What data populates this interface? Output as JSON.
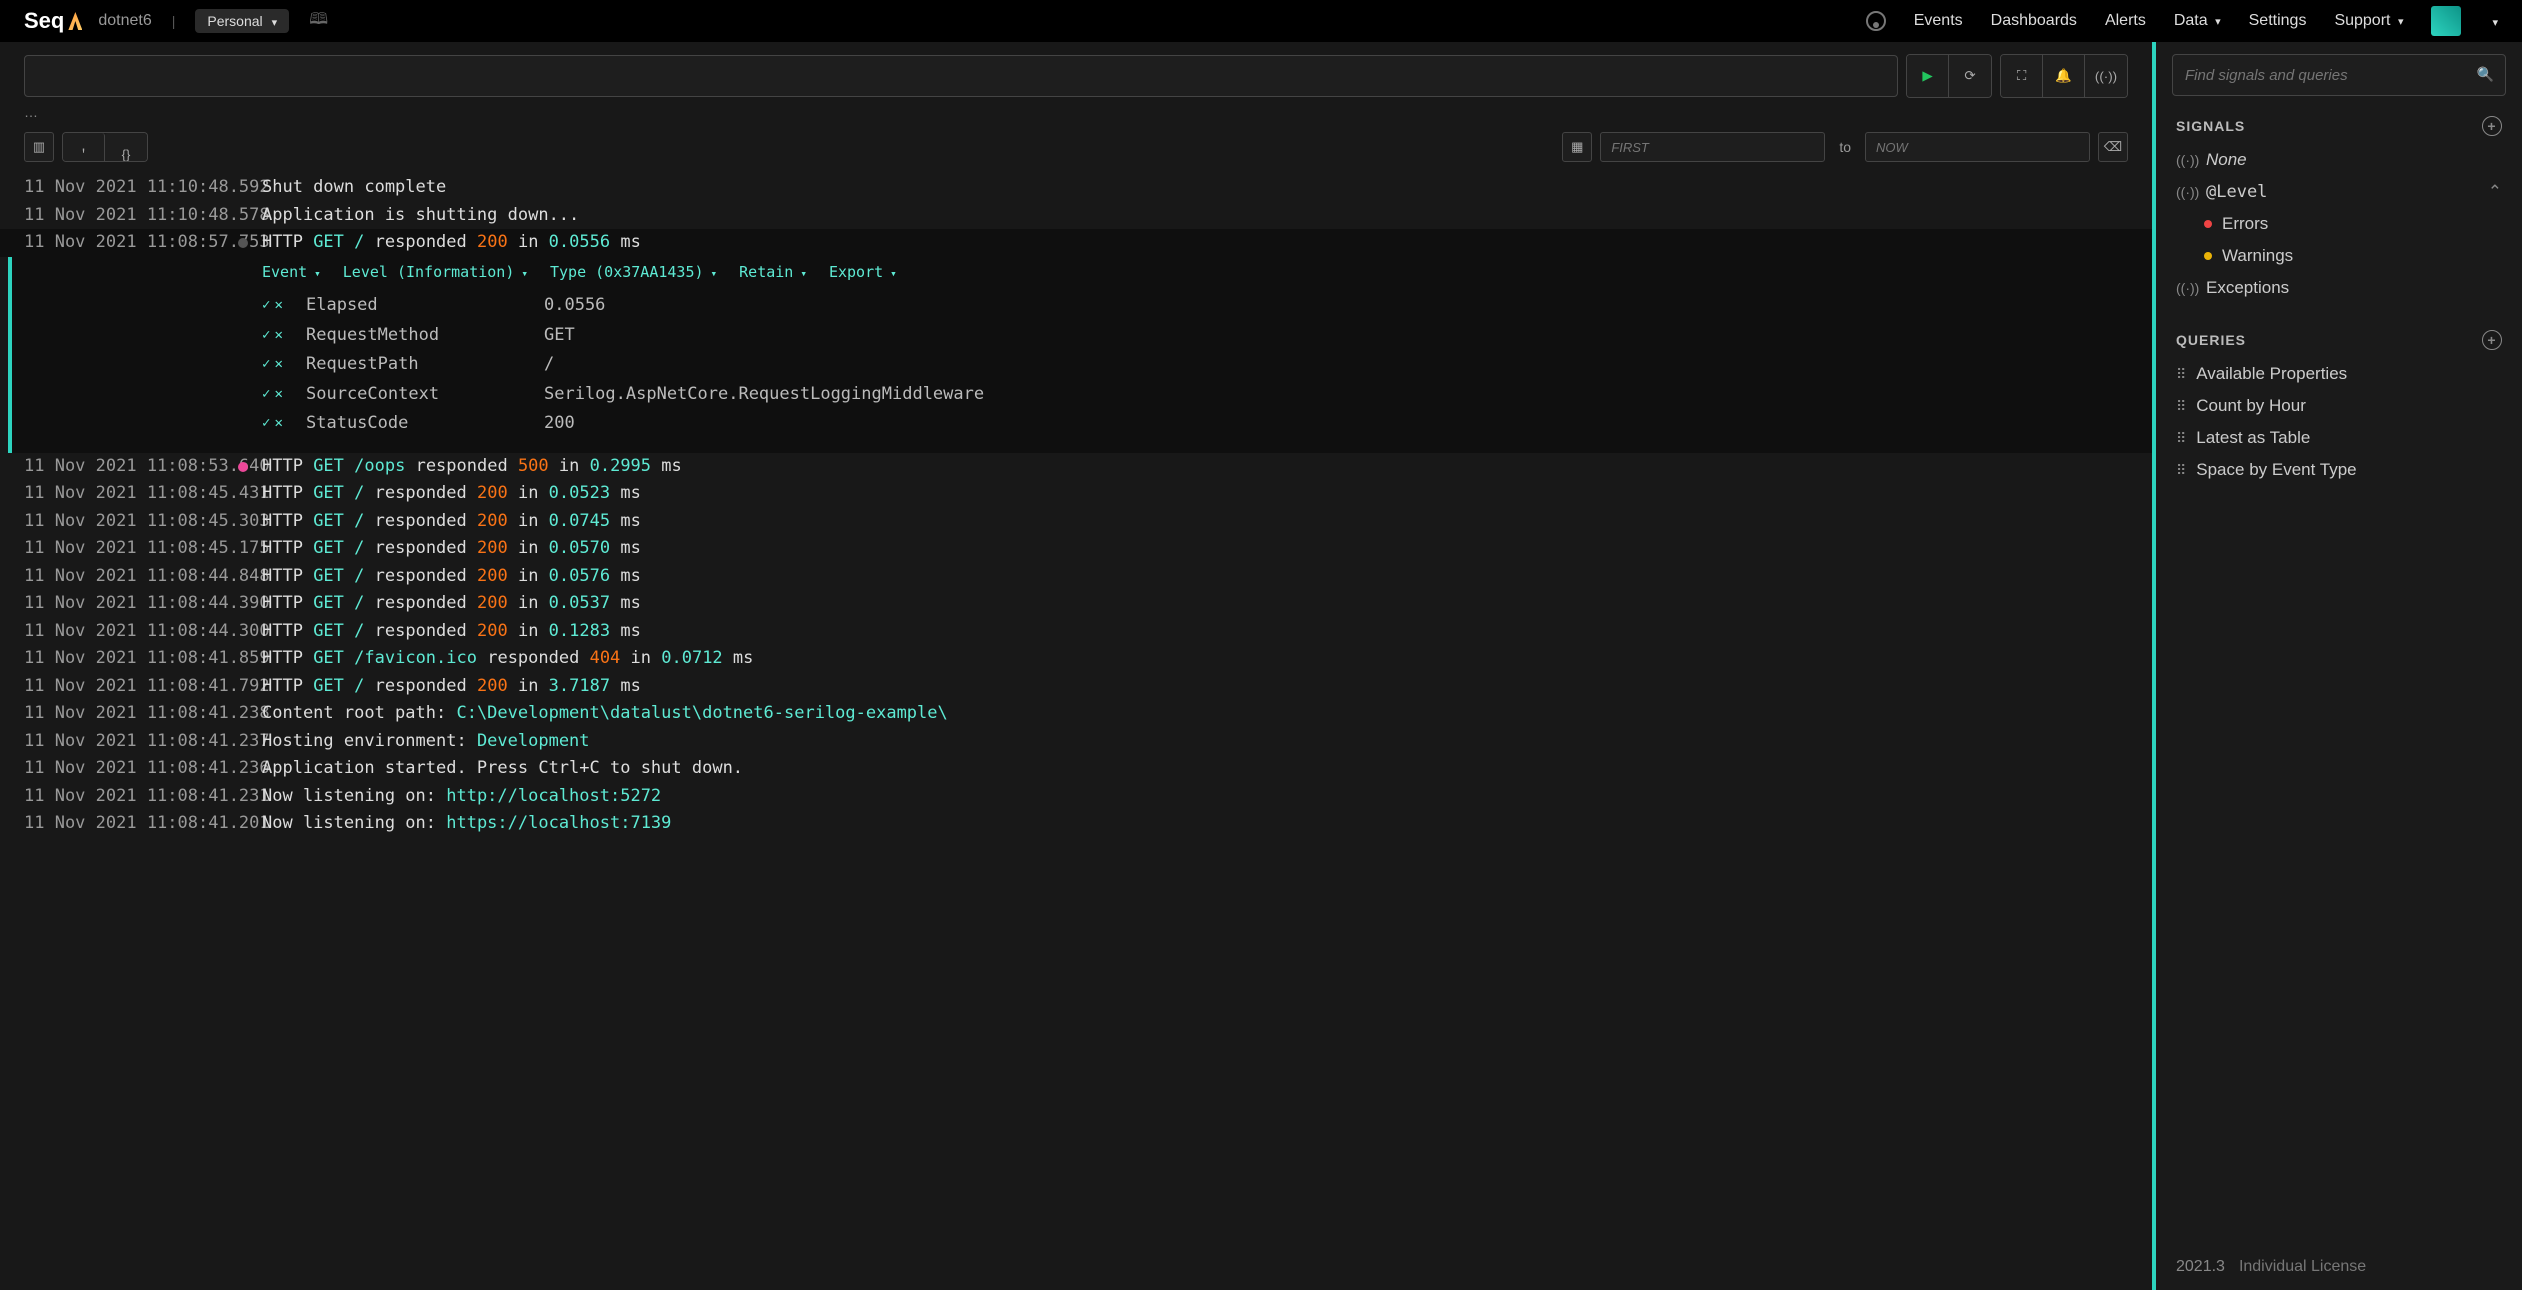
{
  "nav": {
    "logo": "Seq",
    "project": "dotnet6",
    "workspace": "Personal",
    "links": [
      "Events",
      "Dashboards",
      "Alerts",
      "Data",
      "Settings",
      "Support"
    ]
  },
  "query": {
    "ellipsis": "…",
    "from_placeholder": "FIRST",
    "to_placeholder": "NOW",
    "to_label": "to"
  },
  "events": [
    {
      "ts": "11 Nov 2021 11:10:48.592",
      "dot": "none",
      "msg": "Shut down complete"
    },
    {
      "ts": "11 Nov 2021 11:10:48.578",
      "dot": "none",
      "msg": "Application is shutting down..."
    },
    {
      "ts": "11 Nov 2021 11:08:57.753",
      "dot": "info",
      "expanded": true,
      "method": "GET",
      "path": "/",
      "status": "200",
      "elapsed": "0.0556"
    },
    {
      "ts": "11 Nov 2021 11:08:53.640",
      "dot": "error",
      "method": "GET",
      "path": "/oops",
      "status": "500",
      "elapsed": "0.2995"
    },
    {
      "ts": "11 Nov 2021 11:08:45.431",
      "dot": "none",
      "method": "GET",
      "path": "/",
      "status": "200",
      "elapsed": "0.0523"
    },
    {
      "ts": "11 Nov 2021 11:08:45.303",
      "dot": "none",
      "method": "GET",
      "path": "/",
      "status": "200",
      "elapsed": "0.0745"
    },
    {
      "ts": "11 Nov 2021 11:08:45.175",
      "dot": "none",
      "method": "GET",
      "path": "/",
      "status": "200",
      "elapsed": "0.0570"
    },
    {
      "ts": "11 Nov 2021 11:08:44.848",
      "dot": "none",
      "method": "GET",
      "path": "/",
      "status": "200",
      "elapsed": "0.0576"
    },
    {
      "ts": "11 Nov 2021 11:08:44.390",
      "dot": "none",
      "method": "GET",
      "path": "/",
      "status": "200",
      "elapsed": "0.0537"
    },
    {
      "ts": "11 Nov 2021 11:08:44.300",
      "dot": "none",
      "method": "GET",
      "path": "/",
      "status": "200",
      "elapsed": "0.1283"
    },
    {
      "ts": "11 Nov 2021 11:08:41.859",
      "dot": "none",
      "method": "GET",
      "path": "/favicon.ico",
      "status": "404",
      "elapsed": "0.0712"
    },
    {
      "ts": "11 Nov 2021 11:08:41.792",
      "dot": "none",
      "method": "GET",
      "path": "/",
      "status": "200",
      "elapsed": "3.7187"
    },
    {
      "ts": "11 Nov 2021 11:08:41.238",
      "dot": "none",
      "plain_prefix": "Content root path: ",
      "plain_hl": "C:\\Development\\datalust\\dotnet6-serilog-example\\"
    },
    {
      "ts": "11 Nov 2021 11:08:41.237",
      "dot": "none",
      "plain_prefix": "Hosting environment: ",
      "plain_hl": "Development"
    },
    {
      "ts": "11 Nov 2021 11:08:41.236",
      "dot": "none",
      "msg": "Application started. Press Ctrl+C to shut down."
    },
    {
      "ts": "11 Nov 2021 11:08:41.231",
      "dot": "none",
      "plain_prefix": "Now listening on: ",
      "plain_hl": "http://localhost:5272"
    },
    {
      "ts": "11 Nov 2021 11:08:41.201",
      "dot": "none",
      "plain_prefix": "Now listening on: ",
      "plain_hl": "https://localhost:7139"
    }
  ],
  "detail": {
    "actions": [
      "Event",
      "Level (Information)",
      "Type (0x37AA1435)",
      "Retain",
      "Export"
    ],
    "props": [
      {
        "k": "Elapsed",
        "v": "0.0556"
      },
      {
        "k": "RequestMethod",
        "v": "GET"
      },
      {
        "k": "RequestPath",
        "v": "/"
      },
      {
        "k": "SourceContext",
        "v": "Serilog.AspNetCore.RequestLoggingMiddleware"
      },
      {
        "k": "StatusCode",
        "v": "200"
      }
    ]
  },
  "sidebar": {
    "search_placeholder": "Find signals and queries",
    "signals_header": "SIGNALS",
    "queries_header": "QUERIES",
    "signals": {
      "none": "None",
      "level": "@Level",
      "errors": "Errors",
      "warnings": "Warnings",
      "exceptions": "Exceptions"
    },
    "queries": [
      "Available Properties",
      "Count by Hour",
      "Latest as Table",
      "Space by Event Type"
    ],
    "footer_version": "2021.3",
    "footer_license": "Individual License"
  }
}
